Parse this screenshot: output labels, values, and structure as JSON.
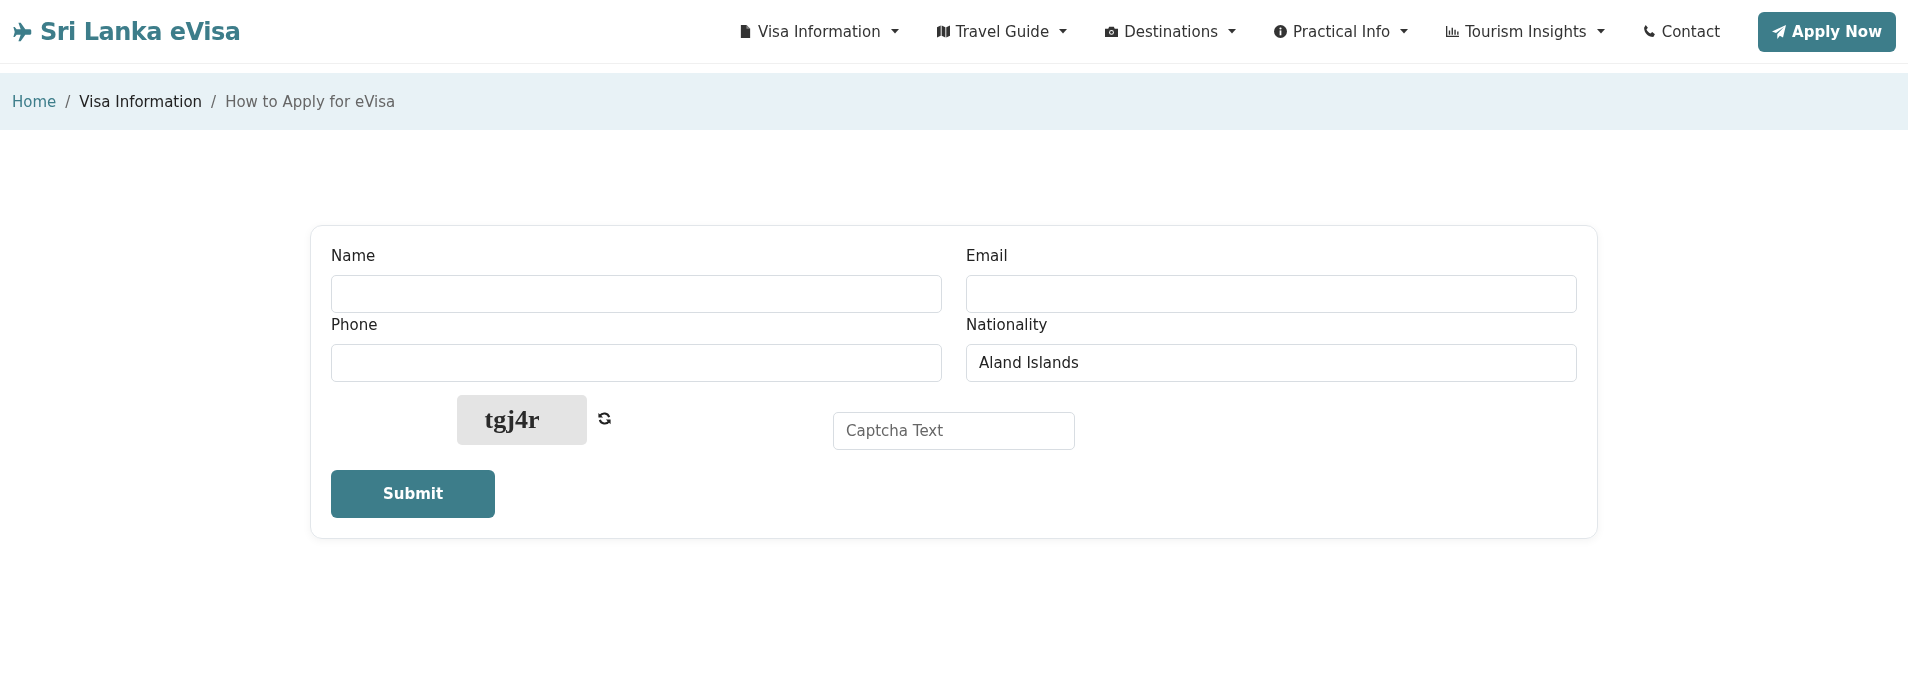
{
  "brand": {
    "title": "Sri Lanka eVisa"
  },
  "nav": [
    {
      "label": "Visa Information",
      "dropdown": true
    },
    {
      "label": "Travel Guide",
      "dropdown": true
    },
    {
      "label": "Destinations",
      "dropdown": true
    },
    {
      "label": "Practical Info",
      "dropdown": true
    },
    {
      "label": "Tourism Insights",
      "dropdown": true
    },
    {
      "label": "Contact",
      "dropdown": false
    }
  ],
  "apply_button": "Apply Now",
  "breadcrumb": [
    {
      "label": "Home",
      "kind": "link"
    },
    {
      "separator": "/",
      "label": "Visa Information",
      "kind": "parent"
    },
    {
      "separator": "/",
      "label": "How to Apply for eVisa",
      "kind": "current"
    }
  ],
  "form": {
    "fields": [
      {
        "label": "Name"
      },
      {
        "label": "Email"
      },
      {
        "label": "Phone"
      },
      {
        "label": "Nationality",
        "value": "Aland Islands"
      }
    ],
    "captcha": {
      "code": "tgj4r",
      "placeholder": "Captcha Text"
    },
    "submit": "Submit"
  }
}
